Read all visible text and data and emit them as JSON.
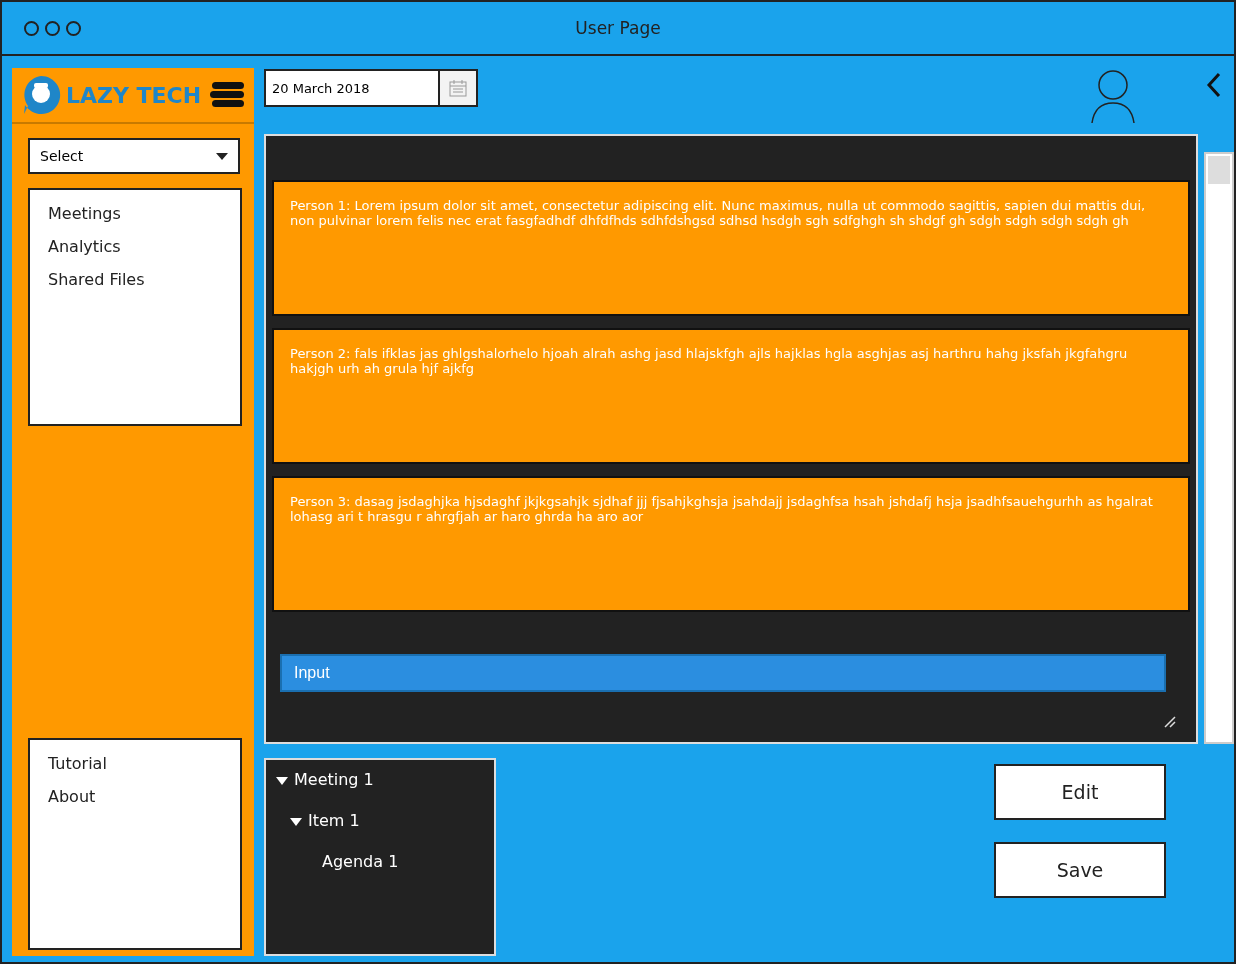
{
  "window": {
    "title": "User Page"
  },
  "brand": {
    "name": "LAZY TECH"
  },
  "sidebar": {
    "select": {
      "value": "Select"
    },
    "nav_items": [
      {
        "label": "Meetings"
      },
      {
        "label": "Analytics"
      },
      {
        "label": "Shared Files"
      }
    ],
    "footer_items": [
      {
        "label": "Tutorial"
      },
      {
        "label": "About"
      }
    ]
  },
  "date_field": {
    "value": "20 March 2018"
  },
  "messages": [
    {
      "text": "Person 1: Lorem ipsum dolor sit amet, consectetur adipiscing elit. Nunc maximus, nulla ut commodo sagittis, sapien dui mattis dui, non pulvinar lorem felis nec erat fasgfadhdf dhfdfhds sdhfdshgsd sdhsd hsdgh sgh sdfghgh sh shdgf gh sdgh sdgh sdgh sdgh gh"
    },
    {
      "text": "Person 2: fals ifklas jas ghlgshalorhelo hjoah alrah ashg jasd hlajskfgh ajls hajklas hgla asghjas asj harthru hahg jksfah jkgfahgru hakjgh urh ah grula hjf ajkfg"
    },
    {
      "text": "Person 3: dasag jsdaghjka hjsdaghf jkjkgsahjk sjdhaf jjj fjsahjkghsja jsahdajj jsdaghfsa hsah jshdafj hsja jsadhfsauehgurhh as hgalrat lohasg ari t hrasgu r ahrgfjah ar haro ghrda ha aro aor"
    }
  ],
  "input": {
    "placeholder": "Input"
  },
  "tree": [
    {
      "label": "Meeting 1",
      "expanded": true,
      "children": [
        {
          "label": "Item 1",
          "expanded": true,
          "children": [
            {
              "label": "Agenda 1"
            }
          ]
        }
      ]
    }
  ],
  "buttons": [
    {
      "label": "Edit"
    },
    {
      "label": "Save"
    }
  ]
}
